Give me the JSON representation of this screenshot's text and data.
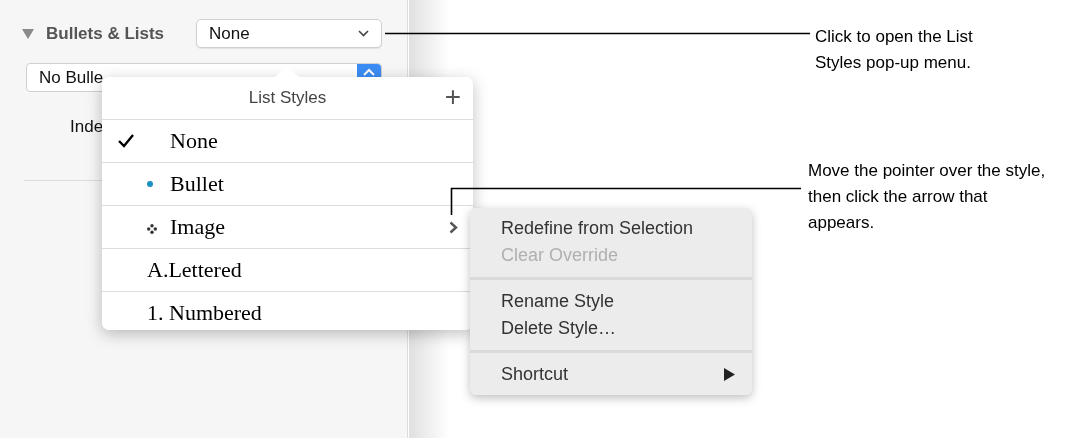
{
  "inspector": {
    "section_title": "Bullets & Lists",
    "expanded": true,
    "style_popup": "None",
    "bullet_select": "No Bulle",
    "indent_label": "Inde"
  },
  "list_styles_popover": {
    "title": "List Styles",
    "add_button": "+",
    "items": [
      {
        "kind": "none",
        "label": "None",
        "selected": true,
        "has_submenu": false
      },
      {
        "kind": "bullet",
        "label": "Bullet",
        "selected": false,
        "has_submenu": false
      },
      {
        "kind": "image",
        "label": "Image",
        "selected": false,
        "has_submenu": true
      },
      {
        "kind": "lettered",
        "marker": "A.",
        "label": "Lettered",
        "selected": false,
        "has_submenu": false
      },
      {
        "kind": "numbered",
        "marker": "1.",
        "label": "Numbered",
        "selected": false,
        "has_submenu": false
      }
    ]
  },
  "context_menu": {
    "items": [
      {
        "kind": "item",
        "label": "Redefine from Selection",
        "disabled": false,
        "has_submenu": false
      },
      {
        "kind": "item",
        "label": "Clear Override",
        "disabled": true,
        "has_submenu": false
      },
      {
        "kind": "separator"
      },
      {
        "kind": "item",
        "label": "Rename Style",
        "disabled": false,
        "has_submenu": false
      },
      {
        "kind": "item",
        "label": "Delete Style…",
        "disabled": false,
        "has_submenu": false
      },
      {
        "kind": "separator"
      },
      {
        "kind": "item",
        "label": "Shortcut",
        "disabled": false,
        "has_submenu": true
      }
    ]
  },
  "callouts": [
    {
      "text": "Click to open the List Styles pop-up menu."
    },
    {
      "text": "Move the pointer over the style, then click the arrow that appears."
    }
  ]
}
